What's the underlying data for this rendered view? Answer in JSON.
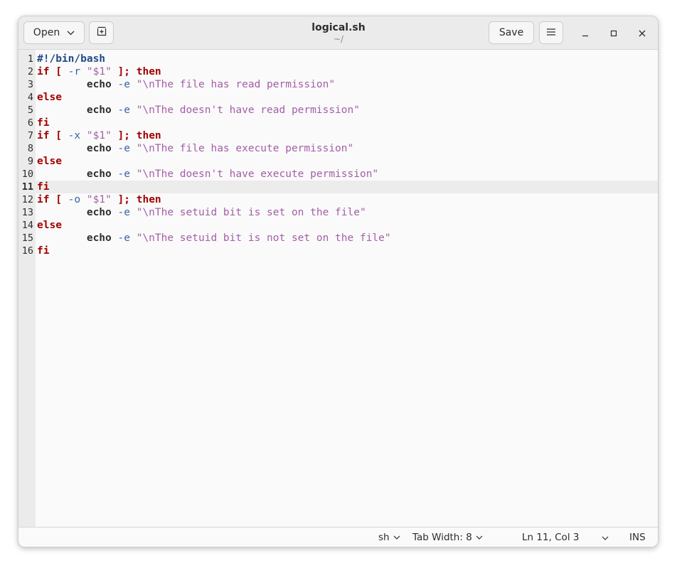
{
  "header": {
    "open_label": "Open",
    "save_label": "Save",
    "title": "logical.sh",
    "subtitle": "~/"
  },
  "editor": {
    "current_line": 11,
    "lines": [
      {
        "n": "1",
        "tokens": [
          {
            "c": "sh",
            "t": "#!/bin/bash"
          }
        ]
      },
      {
        "n": "2",
        "tokens": [
          {
            "c": "k",
            "t": "if"
          },
          {
            "c": "p",
            "t": " "
          },
          {
            "c": "k",
            "t": "["
          },
          {
            "c": "p",
            "t": " "
          },
          {
            "c": "o",
            "t": "-r"
          },
          {
            "c": "p",
            "t": " "
          },
          {
            "c": "s",
            "t": "\"$1\""
          },
          {
            "c": "p",
            "t": " "
          },
          {
            "c": "k",
            "t": "];"
          },
          {
            "c": "p",
            "t": " "
          },
          {
            "c": "k",
            "t": "then"
          }
        ]
      },
      {
        "n": "3",
        "tokens": [
          {
            "c": "p",
            "t": "        "
          },
          {
            "c": "b",
            "t": "echo"
          },
          {
            "c": "p",
            "t": " "
          },
          {
            "c": "o",
            "t": "-e"
          },
          {
            "c": "p",
            "t": " "
          },
          {
            "c": "s",
            "t": "\"\\nThe file has read permission\""
          }
        ]
      },
      {
        "n": "4",
        "tokens": [
          {
            "c": "k",
            "t": "else"
          }
        ]
      },
      {
        "n": "5",
        "tokens": [
          {
            "c": "p",
            "t": "        "
          },
          {
            "c": "b",
            "t": "echo"
          },
          {
            "c": "p",
            "t": " "
          },
          {
            "c": "o",
            "t": "-e"
          },
          {
            "c": "p",
            "t": " "
          },
          {
            "c": "s",
            "t": "\"\\nThe doesn't have read permission\""
          }
        ]
      },
      {
        "n": "6",
        "tokens": [
          {
            "c": "k",
            "t": "fi"
          }
        ]
      },
      {
        "n": "7",
        "tokens": [
          {
            "c": "k",
            "t": "if"
          },
          {
            "c": "p",
            "t": " "
          },
          {
            "c": "k",
            "t": "["
          },
          {
            "c": "p",
            "t": " "
          },
          {
            "c": "o",
            "t": "-x"
          },
          {
            "c": "p",
            "t": " "
          },
          {
            "c": "s",
            "t": "\"$1\""
          },
          {
            "c": "p",
            "t": " "
          },
          {
            "c": "k",
            "t": "];"
          },
          {
            "c": "p",
            "t": " "
          },
          {
            "c": "k",
            "t": "then"
          }
        ]
      },
      {
        "n": "8",
        "tokens": [
          {
            "c": "p",
            "t": "        "
          },
          {
            "c": "b",
            "t": "echo"
          },
          {
            "c": "p",
            "t": " "
          },
          {
            "c": "o",
            "t": "-e"
          },
          {
            "c": "p",
            "t": " "
          },
          {
            "c": "s",
            "t": "\"\\nThe file has execute permission\""
          }
        ]
      },
      {
        "n": "9",
        "tokens": [
          {
            "c": "k",
            "t": "else"
          }
        ]
      },
      {
        "n": "10",
        "tokens": [
          {
            "c": "p",
            "t": "        "
          },
          {
            "c": "b",
            "t": "echo"
          },
          {
            "c": "p",
            "t": " "
          },
          {
            "c": "o",
            "t": "-e"
          },
          {
            "c": "p",
            "t": " "
          },
          {
            "c": "s",
            "t": "\"\\nThe doesn't have execute permission\""
          }
        ]
      },
      {
        "n": "11",
        "tokens": [
          {
            "c": "k",
            "t": "fi"
          }
        ]
      },
      {
        "n": "12",
        "tokens": [
          {
            "c": "k",
            "t": "if"
          },
          {
            "c": "p",
            "t": " "
          },
          {
            "c": "k",
            "t": "["
          },
          {
            "c": "p",
            "t": " "
          },
          {
            "c": "o",
            "t": "-o"
          },
          {
            "c": "p",
            "t": " "
          },
          {
            "c": "s",
            "t": "\"$1\""
          },
          {
            "c": "p",
            "t": " "
          },
          {
            "c": "k",
            "t": "];"
          },
          {
            "c": "p",
            "t": " "
          },
          {
            "c": "k",
            "t": "then"
          }
        ]
      },
      {
        "n": "13",
        "tokens": [
          {
            "c": "p",
            "t": "        "
          },
          {
            "c": "b",
            "t": "echo"
          },
          {
            "c": "p",
            "t": " "
          },
          {
            "c": "o",
            "t": "-e"
          },
          {
            "c": "p",
            "t": " "
          },
          {
            "c": "s",
            "t": "\"\\nThe setuid bit is set on the file\""
          }
        ]
      },
      {
        "n": "14",
        "tokens": [
          {
            "c": "k",
            "t": "else"
          }
        ]
      },
      {
        "n": "15",
        "tokens": [
          {
            "c": "p",
            "t": "        "
          },
          {
            "c": "b",
            "t": "echo"
          },
          {
            "c": "p",
            "t": " "
          },
          {
            "c": "o",
            "t": "-e"
          },
          {
            "c": "p",
            "t": " "
          },
          {
            "c": "s",
            "t": "\"\\nThe setuid bit is not set on the file\""
          }
        ]
      },
      {
        "n": "16",
        "tokens": [
          {
            "c": "k",
            "t": "fi"
          }
        ]
      }
    ]
  },
  "statusbar": {
    "language": "sh",
    "tab_width": "Tab Width: 8",
    "position": "Ln 11, Col 3",
    "mode": "INS"
  },
  "icons": {
    "open_dropdown": "chevron-down-icon",
    "new_tab": "new-tab-icon",
    "menu": "hamburger-menu-icon",
    "minimize": "minimize-icon",
    "maximize": "maximize-icon",
    "close": "close-icon"
  },
  "colors": {
    "keyword": "#a40000",
    "shebang": "#204a87",
    "option": "#3465a4",
    "string": "#a35fa6",
    "current_line": "#ececec"
  }
}
